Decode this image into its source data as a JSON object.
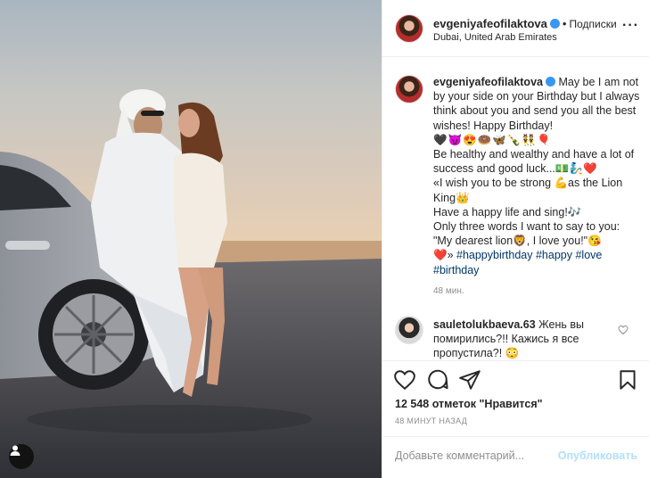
{
  "post": {
    "author": "evgeniyafeofilaktova",
    "location": "Dubai, United Arab Emirates",
    "follow_label": "Подписки",
    "separator": "•",
    "more_icon": "ellipsis-icon"
  },
  "caption": {
    "author": "evgeniyafeofilaktova",
    "line1": "May be I am not by your side on your Birthday but I always think about you and send you all the best wishes! Happy Birthday!",
    "emoji_row": "🖤😈😍🍩🦋🍾👯🎈",
    "line2": "Be healthy and wealthy and have a lot of success and good luck...💵🧞❤️",
    "line3": "«I wish you to be strong 💪as the Lion King👑",
    "line4": "Have a happy life and sing!🎶",
    "line5": "Only three words I want to say to you: \"My dearest lion🦁, I love you!\"😘",
    "line6_prefix": "❤️» ",
    "hashtags": [
      "#happybirthday",
      "#happy",
      "#love",
      "#birthday"
    ],
    "time": "48 мин."
  },
  "comment": {
    "author": "sauletolukbaeva.63",
    "text": "Жень вы помирились?!! Кажись я все пропустила?! 😳"
  },
  "actions": {
    "likes": "12 548 отметок \"Нравится\"",
    "time_ago": "48 МИНУТ НАЗАД",
    "comment_placeholder": "Добавьте комментарий...",
    "publish_label": "Опубликовать"
  },
  "colors": {
    "verified": "#3897f0",
    "hashtag": "#00376b",
    "publish_disabled": "#b2dffc",
    "muted": "#8e8e8e"
  }
}
